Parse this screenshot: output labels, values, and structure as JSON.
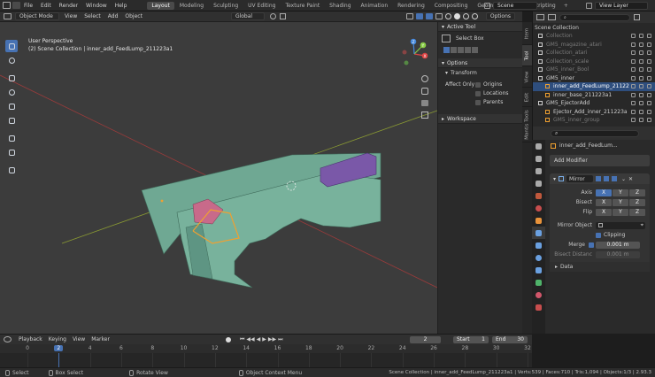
{
  "topbar": {
    "menus": [
      "File",
      "Edit",
      "Render",
      "Window",
      "Help"
    ],
    "workspaces": [
      {
        "label": "Layout",
        "active": true
      },
      {
        "label": "Modeling",
        "active": false
      },
      {
        "label": "Sculpting",
        "active": false
      },
      {
        "label": "UV Editing",
        "active": false
      },
      {
        "label": "Texture Paint",
        "active": false
      },
      {
        "label": "Shading",
        "active": false
      },
      {
        "label": "Animation",
        "active": false
      },
      {
        "label": "Rendering",
        "active": false
      },
      {
        "label": "Compositing",
        "active": false
      },
      {
        "label": "Geometry Nodes",
        "active": false
      },
      {
        "label": "Scripting",
        "active": false
      }
    ],
    "add_tab": "+",
    "scene": "Scene",
    "view_layer": "View Layer"
  },
  "viewport_header": {
    "mode": "Object Mode",
    "menus": [
      "View",
      "Select",
      "Add",
      "Object"
    ],
    "transform_orientation": "Global",
    "options": "Options"
  },
  "viewport": {
    "perspective": "User Perspective",
    "collection_info": "(2) Scene Collection | inner_add_FeedLump_211223a1",
    "gizmo": {
      "x": "X",
      "y": "Y",
      "z": "Z"
    }
  },
  "n_panel": {
    "active_tool_title": "Active Tool",
    "active_tool_name": "Select Box",
    "options_title": "Options",
    "transform_title": "Transform",
    "affect_only_label": "Affect Only",
    "affect_only": [
      "Origins",
      "Locations",
      "Parents"
    ],
    "workspace_title": "Workspace",
    "tabs": [
      "Item",
      "Tool",
      "View",
      "Edit",
      "Mantis Tools"
    ],
    "active_tab": "Tool"
  },
  "outliner": {
    "header": "Scene Collection",
    "rows": [
      {
        "label": "Collection",
        "dim": true,
        "sel": false
      },
      {
        "label": "GM5_magazine_atari",
        "dim": true,
        "sel": false
      },
      {
        "label": "Collection_atari",
        "dim": true,
        "sel": false
      },
      {
        "label": "Collection_scale",
        "dim": true,
        "sel": false
      },
      {
        "label": "GM5_inner_Bool",
        "dim": true,
        "sel": false
      },
      {
        "label": "GM5_inner",
        "dim": false,
        "sel": false
      },
      {
        "label": "inner_add_FeedLump_21122",
        "dim": false,
        "sel": true
      },
      {
        "label": "inner_base_211223a1",
        "dim": false,
        "sel": false
      },
      {
        "label": "GM5_EjectorAdd",
        "dim": false,
        "sel": false
      },
      {
        "label": "Ejector_Add_inner_211223a",
        "dim": false,
        "sel": false
      },
      {
        "label": "GM5_inner_group",
        "dim": true,
        "sel": false
      }
    ]
  },
  "properties": {
    "object_name": "inner_add_FeedLum...",
    "add_modifier": "Add Modifier",
    "modifier_name": "Mirror",
    "axis_label": "Axis",
    "bisect_label": "Bisect",
    "flip_label": "Flip",
    "axis_letters": [
      "X",
      "Y",
      "Z"
    ],
    "axis_on": [
      true,
      false,
      false
    ],
    "mirror_object_label": "Mirror Object",
    "clipping_label": "Clipping",
    "merge_label": "Merge",
    "merge_value": "0.001 m",
    "bisect_distance_label": "Bisect Distanc",
    "bisect_distance_value": "0.001 m",
    "data_label": "Data"
  },
  "timeline": {
    "menus": [
      "Playback",
      "Keying",
      "View",
      "Marker"
    ],
    "current_frame": "2",
    "start_label": "Start",
    "start": "1",
    "end_label": "End",
    "end": "30",
    "ticks": [
      "0",
      "2",
      "4",
      "6",
      "8",
      "10",
      "12",
      "14",
      "16",
      "18",
      "20",
      "22",
      "24",
      "26",
      "28",
      "30",
      "32"
    ],
    "playhead": "2"
  },
  "statusbar": {
    "items": [
      "Select",
      "Box Select",
      "Rotate View",
      "Object Context Menu"
    ],
    "stats": "Scene Collection | inner_add_FeedLump_211223a1 | Verts:539 | Faces:710 | Tris:1,094 | Objects:1/3 | 2.93.3"
  },
  "colors": {
    "accent": "#4772b3",
    "mesh": "#6fa893",
    "selected_outline": "#f0a030",
    "purple": "#7a58a8",
    "pink": "#c86a8a"
  }
}
